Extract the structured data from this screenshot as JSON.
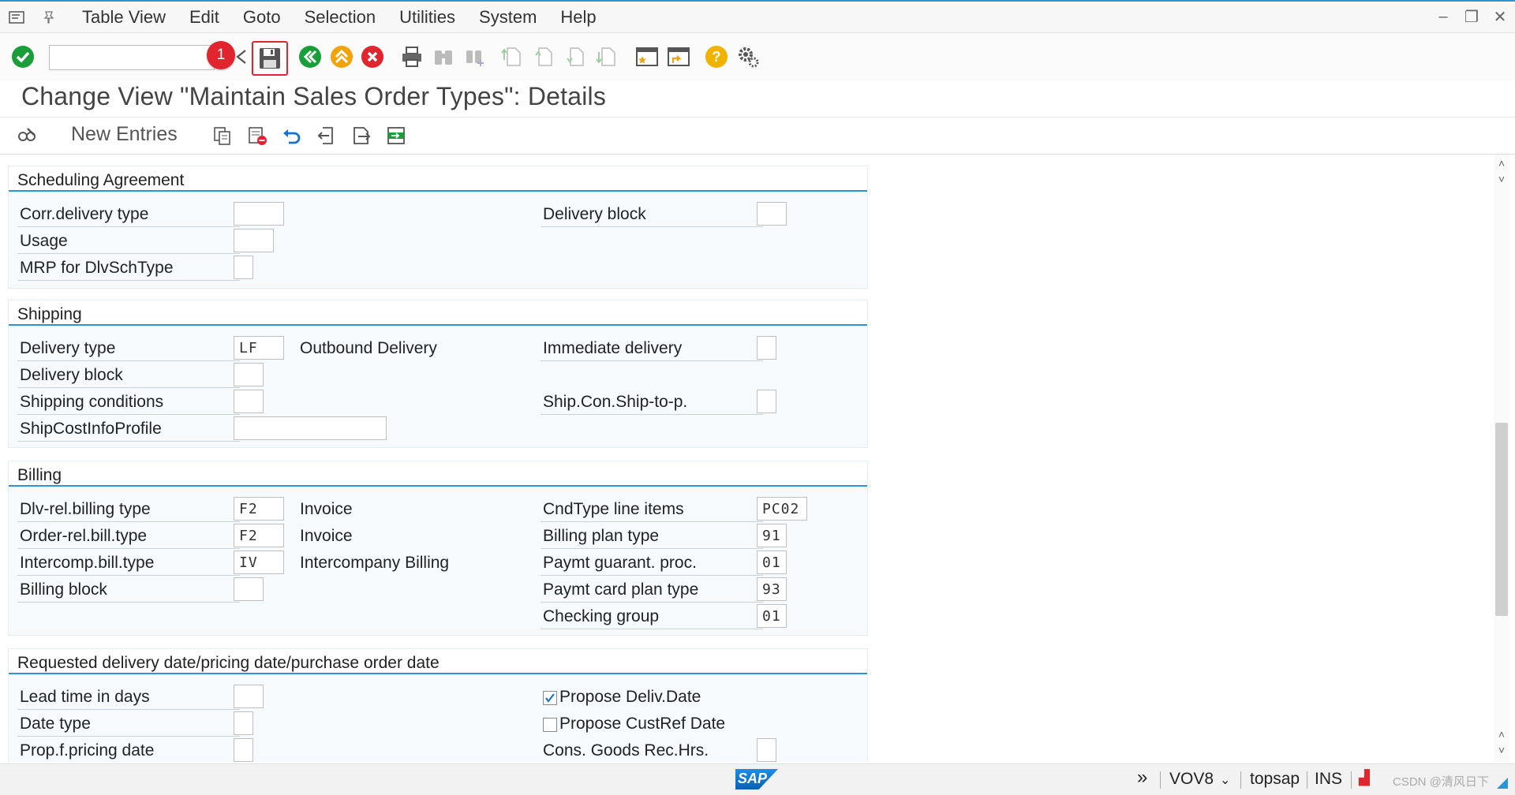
{
  "menubar": {
    "items": [
      "Table View",
      "Edit",
      "Goto",
      "Selection",
      "Utilities",
      "System",
      "Help"
    ]
  },
  "toolbar": {
    "command_field_value": "",
    "badge_number": "1"
  },
  "title": "Change View \"Maintain Sales Order Types\": Details",
  "app_toolbar": {
    "new_entries": "New Entries"
  },
  "sections": {
    "scheduling": {
      "title": "Scheduling Agreement",
      "corr_delivery_type": {
        "label": "Corr.delivery type",
        "value": ""
      },
      "usage": {
        "label": "Usage",
        "value": ""
      },
      "mrp": {
        "label": "MRP for DlvSchType",
        "value": ""
      },
      "delivery_block": {
        "label": "Delivery block",
        "value": ""
      }
    },
    "shipping": {
      "title": "Shipping",
      "delivery_type": {
        "label": "Delivery type",
        "value": "LF",
        "desc": "Outbound Delivery"
      },
      "delivery_block": {
        "label": "Delivery block",
        "value": ""
      },
      "shipping_conditions": {
        "label": "Shipping conditions",
        "value": ""
      },
      "ship_cost_info": {
        "label": "ShipCostInfoProfile",
        "value": ""
      },
      "immediate_delivery": {
        "label": "Immediate delivery",
        "value": ""
      },
      "ship_con_ship_to": {
        "label": "Ship.Con.Ship-to-p.",
        "value": ""
      }
    },
    "billing": {
      "title": "Billing",
      "dlv_rel": {
        "label": "Dlv-rel.billing type",
        "value": "F2",
        "desc": "Invoice"
      },
      "order_rel": {
        "label": "Order-rel.bill.type",
        "value": "F2",
        "desc": "Invoice"
      },
      "intercomp": {
        "label": "Intercomp.bill.type",
        "value": "IV",
        "desc": "Intercompany Billing"
      },
      "billing_block": {
        "label": "Billing block",
        "value": ""
      },
      "cndtype": {
        "label": "CndType line items",
        "value": "PC02"
      },
      "billing_plan": {
        "label": "Billing plan type",
        "value": "91"
      },
      "paymt_guarant": {
        "label": "Paymt guarant. proc.",
        "value": "01"
      },
      "paymt_card": {
        "label": "Paymt card plan type",
        "value": "93"
      },
      "checking_group": {
        "label": "Checking group",
        "value": "01"
      }
    },
    "requested": {
      "title": "Requested delivery date/pricing date/purchase order date",
      "lead_time": {
        "label": "Lead time in days",
        "value": ""
      },
      "date_type": {
        "label": "Date type",
        "value": ""
      },
      "prop_pricing": {
        "label": "Prop.f.pricing date",
        "value": ""
      },
      "propose_deliv": {
        "label": "Propose Deliv.Date",
        "checked": true
      },
      "propose_custref": {
        "label": "Propose CustRef Date",
        "checked": false
      },
      "cons_goods": {
        "label": "Cons. Goods Rec.Hrs.",
        "value": ""
      }
    }
  },
  "statusbar": {
    "transaction": "VOV8",
    "server": "topsap",
    "mode": "INS",
    "watermark": "CSDN @清风日下"
  },
  "colors": {
    "accent": "#2b95d6",
    "badge": "#e0252f",
    "ok_green": "#1a9e3a"
  }
}
